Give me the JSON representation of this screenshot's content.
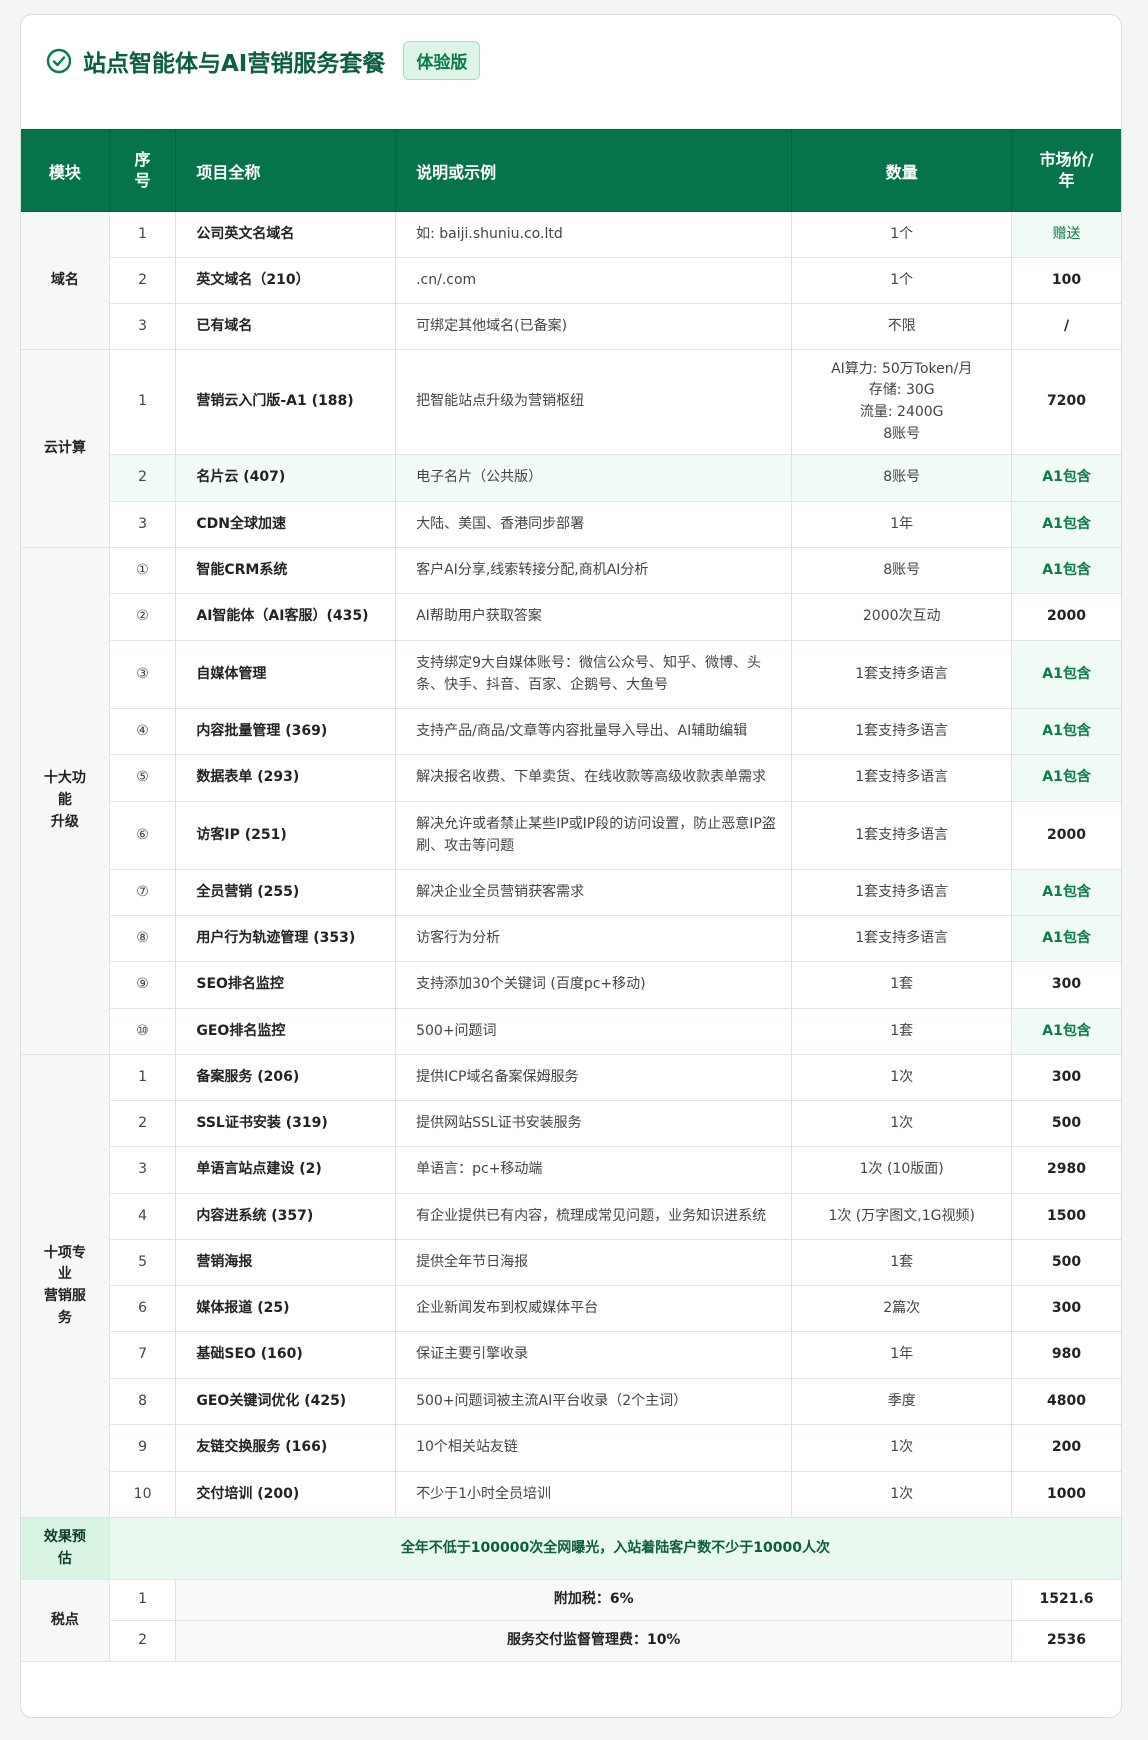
{
  "header": {
    "title": "站点智能体与AI营销服务套餐",
    "badge": "体验版"
  },
  "columns": [
    "模块",
    "序号",
    "项目全称",
    "说明或示例",
    "数量",
    "市场价/年"
  ],
  "sections": [
    {
      "module": "域名",
      "rows": [
        {
          "no": "1",
          "name": "公司英文名域名",
          "desc": "如: baiji.shuniu.co.ltd",
          "qty": "1个",
          "price": "赠送"
        },
        {
          "no": "2",
          "name": "英文域名（210）",
          "desc": ".cn/.com",
          "qty": "1个",
          "price": "100"
        },
        {
          "no": "3",
          "name": "已有域名",
          "desc": "可绑定其他域名(已备案)",
          "qty": "不限",
          "price": "/"
        }
      ]
    },
    {
      "module": "云计算",
      "rows": [
        {
          "no": "1",
          "name": "营销云入门版-A1 (188)",
          "desc": "把智能站点升级为营销枢纽",
          "qty": "AI算力: 50万Token/月\n存储: 30G\n流量: 2400G\n8账号",
          "price": "7200"
        },
        {
          "no": "2",
          "name": "名片云 (407)",
          "desc": "电子名片（公共版）",
          "qty": "8账号",
          "price": "A1包含"
        },
        {
          "no": "3",
          "name": "CDN全球加速",
          "desc": "大陆、美国、香港同步部署",
          "qty": "1年",
          "price": "A1包含"
        }
      ]
    },
    {
      "module": "十大功\n能\n升级",
      "rows": [
        {
          "no": "①",
          "name": "智能CRM系统",
          "desc": "客户AI分享,线索转接分配,商机AI分析",
          "qty": "8账号",
          "price": "A1包含"
        },
        {
          "no": "②",
          "name": "AI智能体（AI客服）(435)",
          "desc": "AI帮助用户获取答案",
          "qty": "2000次互动",
          "price": "2000"
        },
        {
          "no": "③",
          "name": "自媒体管理",
          "desc": "支持绑定9大自媒体账号：微信公众号、知乎、微博、头条、快手、抖音、百家、企鹅号、大鱼号",
          "qty": "1套支持多语言",
          "price": "A1包含"
        },
        {
          "no": "④",
          "name": "内容批量管理 (369)",
          "desc": "支持产品/商品/文章等内容批量导入导出、AI辅助编辑",
          "qty": "1套支持多语言",
          "price": "A1包含"
        },
        {
          "no": "⑤",
          "name": "数据表单 (293)",
          "desc": "解决报名收费、下单卖货、在线收款等高级收款表单需求",
          "qty": "1套支持多语言",
          "price": "A1包含"
        },
        {
          "no": "⑥",
          "name": "访客IP (251)",
          "desc": "解决允许或者禁止某些IP或IP段的访问设置，防止恶意IP盗刷、攻击等问题",
          "qty": "1套支持多语言",
          "price": "2000"
        },
        {
          "no": "⑦",
          "name": "全员营销 (255)",
          "desc": "解决企业全员营销获客需求",
          "qty": "1套支持多语言",
          "price": "A1包含"
        },
        {
          "no": "⑧",
          "name": "用户行为轨迹管理 (353)",
          "desc": "访客行为分析",
          "qty": "1套支持多语言",
          "price": "A1包含"
        },
        {
          "no": "⑨",
          "name": "SEO排名监控",
          "desc": "支持添加30个关键词 (百度pc+移动)",
          "qty": "1套",
          "price": "300"
        },
        {
          "no": "⑩",
          "name": "GEO排名监控",
          "desc": "500+问题词",
          "qty": "1套",
          "price": "A1包含"
        }
      ]
    },
    {
      "module": "十项专\n业\n营销服\n务",
      "rows": [
        {
          "no": "1",
          "name": "备案服务 (206)",
          "desc": "提供ICP域名备案保姆服务",
          "qty": "1次",
          "price": "300"
        },
        {
          "no": "2",
          "name": "SSL证书安装 (319)",
          "desc": "提供网站SSL证书安装服务",
          "qty": "1次",
          "price": "500"
        },
        {
          "no": "3",
          "name": "单语言站点建设 (2)",
          "desc": "单语言：pc+移动端",
          "qty": "1次 (10版面)",
          "price": "2980"
        },
        {
          "no": "4",
          "name": "内容进系统 (357)",
          "desc": "有企业提供已有内容，梳理成常见问题，业务知识进系统",
          "qty": "1次 (万字图文,1G视频)",
          "price": "1500"
        },
        {
          "no": "5",
          "name": "营销海报",
          "desc": "提供全年节日海报",
          "qty": "1套",
          "price": "500"
        },
        {
          "no": "6",
          "name": "媒体报道 (25)",
          "desc": "企业新闻发布到权威媒体平台",
          "qty": "2篇次",
          "price": "300"
        },
        {
          "no": "7",
          "name": "基础SEO (160)",
          "desc": "保证主要引擎收录",
          "qty": "1年",
          "price": "980"
        },
        {
          "no": "8",
          "name": "GEO关键词优化 (425)",
          "desc": "500+问题词被主流AI平台收录（2个主词）",
          "qty": "季度",
          "price": "4800"
        },
        {
          "no": "9",
          "name": "友链交换服务 (166)",
          "desc": "10个相关站友链",
          "qty": "1次",
          "price": "200"
        },
        {
          "no": "10",
          "name": "交付培训 (200)",
          "desc": "不少于1小时全员培训",
          "qty": "1次",
          "price": "1000"
        }
      ]
    }
  ],
  "effect": {
    "label": "效果预\n估",
    "text": "全年不低于100000次全网曝光，入站着陆客户数不少于10000人次"
  },
  "tax": {
    "label": "税点",
    "rows": [
      {
        "no": "1",
        "text": "附加税：6%",
        "price": "1521.6"
      },
      {
        "no": "2",
        "text": "服务交付监督管理费：10%",
        "price": "2536"
      }
    ]
  }
}
